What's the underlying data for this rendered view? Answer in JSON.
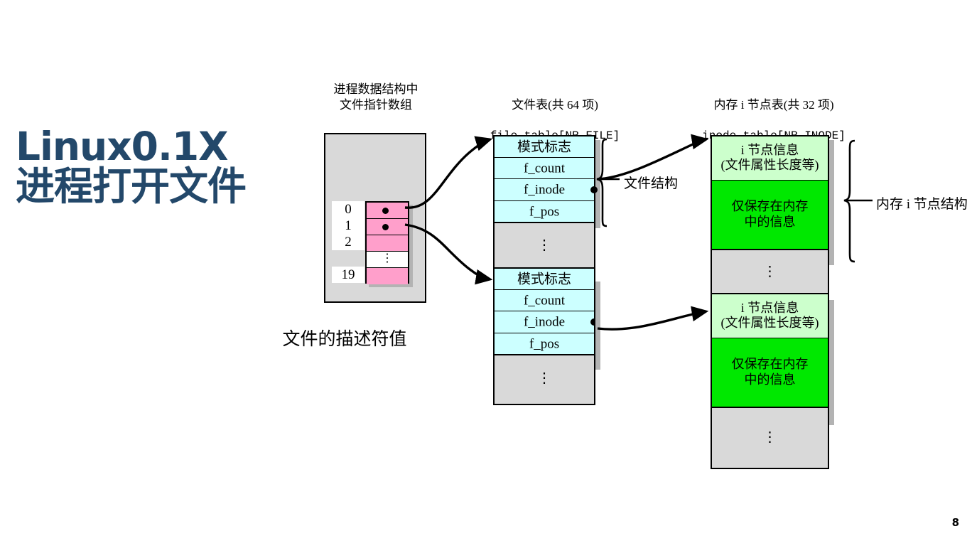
{
  "slide": {
    "title": "Linux0.1X\n进程打开文件",
    "page_number": "8",
    "title_color": "#23486A"
  },
  "headings": {
    "process_array": "进程数据结构中\n文件指针数组",
    "file_table_cn": "文件表(共 64 项)",
    "file_table_code": "file_table[NR_FILE]",
    "inode_table_cn": "内存 i 节点表(共 32 项)",
    "inode_table_code": "inode_table[NR_INODE]"
  },
  "process_array": {
    "caption": "文件的描述符值",
    "indices": [
      "0",
      "1",
      "2",
      "",
      "19"
    ],
    "vdots": "⋮",
    "cells": [
      {
        "index": "0",
        "has_pointer": true,
        "style": "pink"
      },
      {
        "index": "1",
        "has_pointer": true,
        "style": "pink"
      },
      {
        "index": "2",
        "has_pointer": false,
        "style": "pink"
      },
      {
        "index": "",
        "has_pointer": false,
        "style": "dots"
      },
      {
        "index": "19",
        "has_pointer": false,
        "style": "pink"
      }
    ],
    "fill_color": "#FF9FCB",
    "box_color": "#D9D9D9"
  },
  "file_table": {
    "struct_label": "文件结构",
    "vdots": "⋮",
    "blocks": [
      {
        "rows": [
          {
            "label": "模式标志",
            "pointer": false
          },
          {
            "label": "f_count",
            "pointer": false
          },
          {
            "label": "f_inode",
            "pointer": true
          },
          {
            "label": "f_pos",
            "pointer": false
          }
        ]
      },
      {
        "rows": [
          {
            "label": "模式标志",
            "pointer": false
          },
          {
            "label": "f_count",
            "pointer": false
          },
          {
            "label": "f_inode",
            "pointer": true
          },
          {
            "label": "f_pos",
            "pointer": false
          }
        ]
      }
    ],
    "row_color": "#CCFFFF"
  },
  "inode_table": {
    "struct_label": "内存 i 节点结构",
    "vdots": "⋮",
    "blocks": [
      {
        "rows": [
          {
            "label": "i 节点信息\n(文件属性长度等)",
            "style": "lgreen"
          },
          {
            "label": "仅保存在内存\n中的信息",
            "style": "green"
          }
        ]
      },
      {
        "rows": [
          {
            "label": "i 节点信息\n(文件属性长度等)",
            "style": "lgreen"
          },
          {
            "label": "仅保存在内存\n中的信息",
            "style": "green"
          }
        ]
      }
    ],
    "light_color": "#CCFFCC",
    "bright_color": "#00E800"
  }
}
